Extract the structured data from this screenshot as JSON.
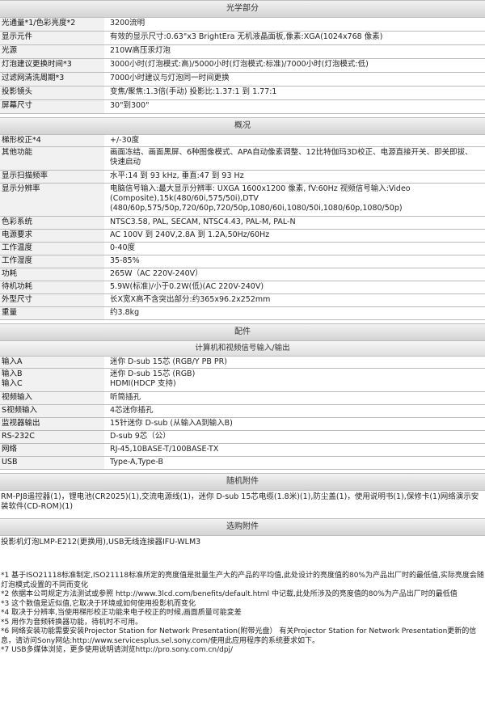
{
  "optics": {
    "title": "光学部分",
    "rows": [
      {
        "k": "光通量*1/色彩亮度*2",
        "v": "3200流明"
      },
      {
        "k": "显示元件",
        "v": "有效的显示尺寸:0.63\"x3 BrightEra 无机液晶面板,像素:XGA(1024x768 像素)"
      },
      {
        "k": "光源",
        "v": "210W高压汞灯泡"
      },
      {
        "k": "灯泡建议更换时间*3",
        "v": "3000小时(灯泡模式:高)/5000小时(灯泡模式:标准)/7000小时(灯泡模式:低)"
      },
      {
        "k": "过滤网清洗周期*3",
        "v": "7000小时建议与灯泡同一时间更换"
      },
      {
        "k": "投影镜头",
        "v": "变焦/聚焦:1.3倍(手动) 投影比:1.37:1 到 1.77:1"
      },
      {
        "k": "屏幕尺寸",
        "v": "30\"到300\""
      }
    ]
  },
  "general": {
    "title": "概况",
    "rows": [
      {
        "k": "梯形校正*4",
        "v": "+/-30度"
      },
      {
        "k": "其他功能",
        "v": "画面冻结、画面黑屏、6种图像模式、APA自动像素调整、12比特伽玛3D校正、电源直接开关、即关即拔、快速启动"
      },
      {
        "k": "显示扫描频率",
        "v": "水平:14 到 93 kHz, 垂直:47 到 93 Hz"
      },
      {
        "k": "显示分辨率",
        "v": "电脑信号输入:最大显示分辨率: UXGA 1600x1200 像素, fV:60Hz 视频信号输入:Video (Composite),15k(480/60i,575/50i),DTV (480/60p,575/50p,720/60p,720/50p,1080/60i,1080/50i,1080/60p,1080/50p)"
      },
      {
        "k": "色彩系统",
        "v": "NTSC3.58, PAL, SECAM, NTSC4.43, PAL-M, PAL-N"
      },
      {
        "k": "电源要求",
        "v": "AC 100V 到 240V,2.8A 到 1.2A,50Hz/60Hz"
      },
      {
        "k": "工作温度",
        "v": "0-40度"
      },
      {
        "k": "工作湿度",
        "v": "35-85%"
      },
      {
        "k": "功耗",
        "v": "265W（AC 220V-240V）"
      },
      {
        "k": "待机功耗",
        "v": "5.9W(标准)/小于0.2W(低)(AC 220V-240V)"
      },
      {
        "k": "外型尺寸",
        "v": "长X宽X高不含突出部分:约365x96.2x252mm"
      },
      {
        "k": "重量",
        "v": "约3.8kg"
      }
    ]
  },
  "accessories_section": {
    "title": "配件",
    "subtitle": "计算机和视频信号输入/输出",
    "rows": [
      {
        "k": "输入A",
        "v": "迷你 D-sub 15芯 (RGB/Y PB PR)"
      },
      {
        "k": "输入B\n输入C",
        "v": "迷你 D-sub 15芯 (RGB)\nHDMI(HDCP 支持)"
      },
      {
        "k": "视频输入",
        "v": "听筒插孔"
      },
      {
        "k": "S视频输入",
        "v": "4芯迷你插孔"
      },
      {
        "k": "监视器输出",
        "v": "15针迷你 D-sub (从输入A到输入B)"
      },
      {
        "k": "RS-232C",
        "v": "D-sub 9芯（公）"
      },
      {
        "k": "网络",
        "v": "RJ-45,10BASE-T/100BASE-TX"
      },
      {
        "k": "USB",
        "v": "Type-A,Type-B"
      }
    ]
  },
  "included": {
    "title": "随机附件",
    "text": "RM-PJ8遥控器(1)，锂电池(CR2025)(1),交流电源线(1)，迷你 D-sub 15芯电缆(1.8米)(1),防尘盖(1)，使用说明书(1),保修卡(1)网络演示安装软件(CD-ROM)(1)"
  },
  "optional": {
    "title": "选购附件",
    "text": "投影机灯泡LMP-E212(更换用),USB无线连接器IFU-WLM3"
  },
  "notes": [
    "*1 基于ISO21118标准制定,ISO21118标准所定的亮度值是批量生产大的产品的平均值,此处设计的亮度值的80%为产品出厂时的最低值,实际亮度会随灯泡模式设置的不同而变化",
    "*2 依据本公司规定方法测试或参照 http://www.3lcd.com/benefits/default.html 中记载,此处所涉及的亮度值的80%为产品出厂时的最低值",
    "*3 这个数值是近似值,它取决于环境或如何使用投影机而变化",
    "*4 取决于分辨率,当使用梯形校正功能来电子校正的时候,画面质量可能変差",
    "*5 用作为音频转换器功能，待机时不可用。",
    "*6 网络安装功能需要安装Projector Station for Network Presentation(附带光盘）  有关Projector Station for Network Presentation更新的信息，请访问Sony网站:http://www.servicesplus.sel.sony.com/使用此应用程序的系统要求如下。",
    "*7 USB多媒体浏览，更多使用说明请浏览http://pro.sony.com.cn/dpj/"
  ]
}
